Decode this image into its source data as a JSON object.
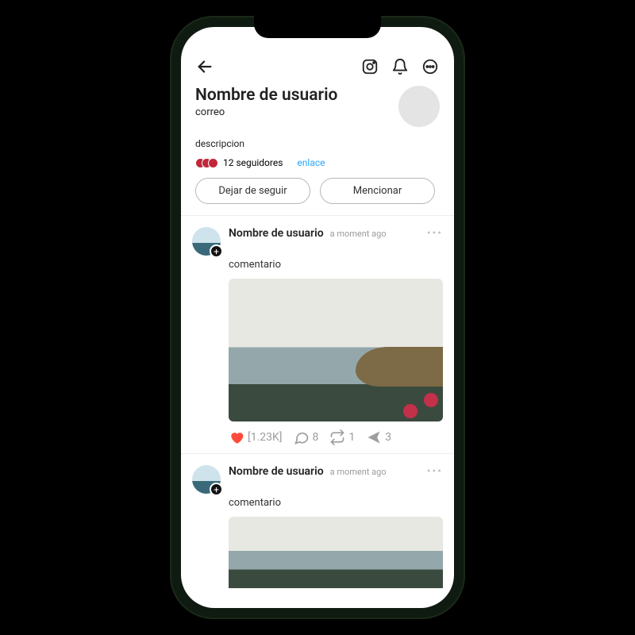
{
  "profile": {
    "username": "Nombre de usuario",
    "email": "correo",
    "description": "descripcion",
    "followers_count": "12 seguidores",
    "link_label": "enlace",
    "unfollow_label": "Dejar de seguir",
    "mention_label": "Mencionar"
  },
  "posts": [
    {
      "user": "Nombre de usuario",
      "time": "a moment ago",
      "comment": "comentario",
      "likes": "[1.23K]",
      "comments": "8",
      "reposts": "1",
      "sends": "3"
    },
    {
      "user": "Nombre de usuario",
      "time": "a moment ago",
      "comment": "comentario"
    }
  ]
}
